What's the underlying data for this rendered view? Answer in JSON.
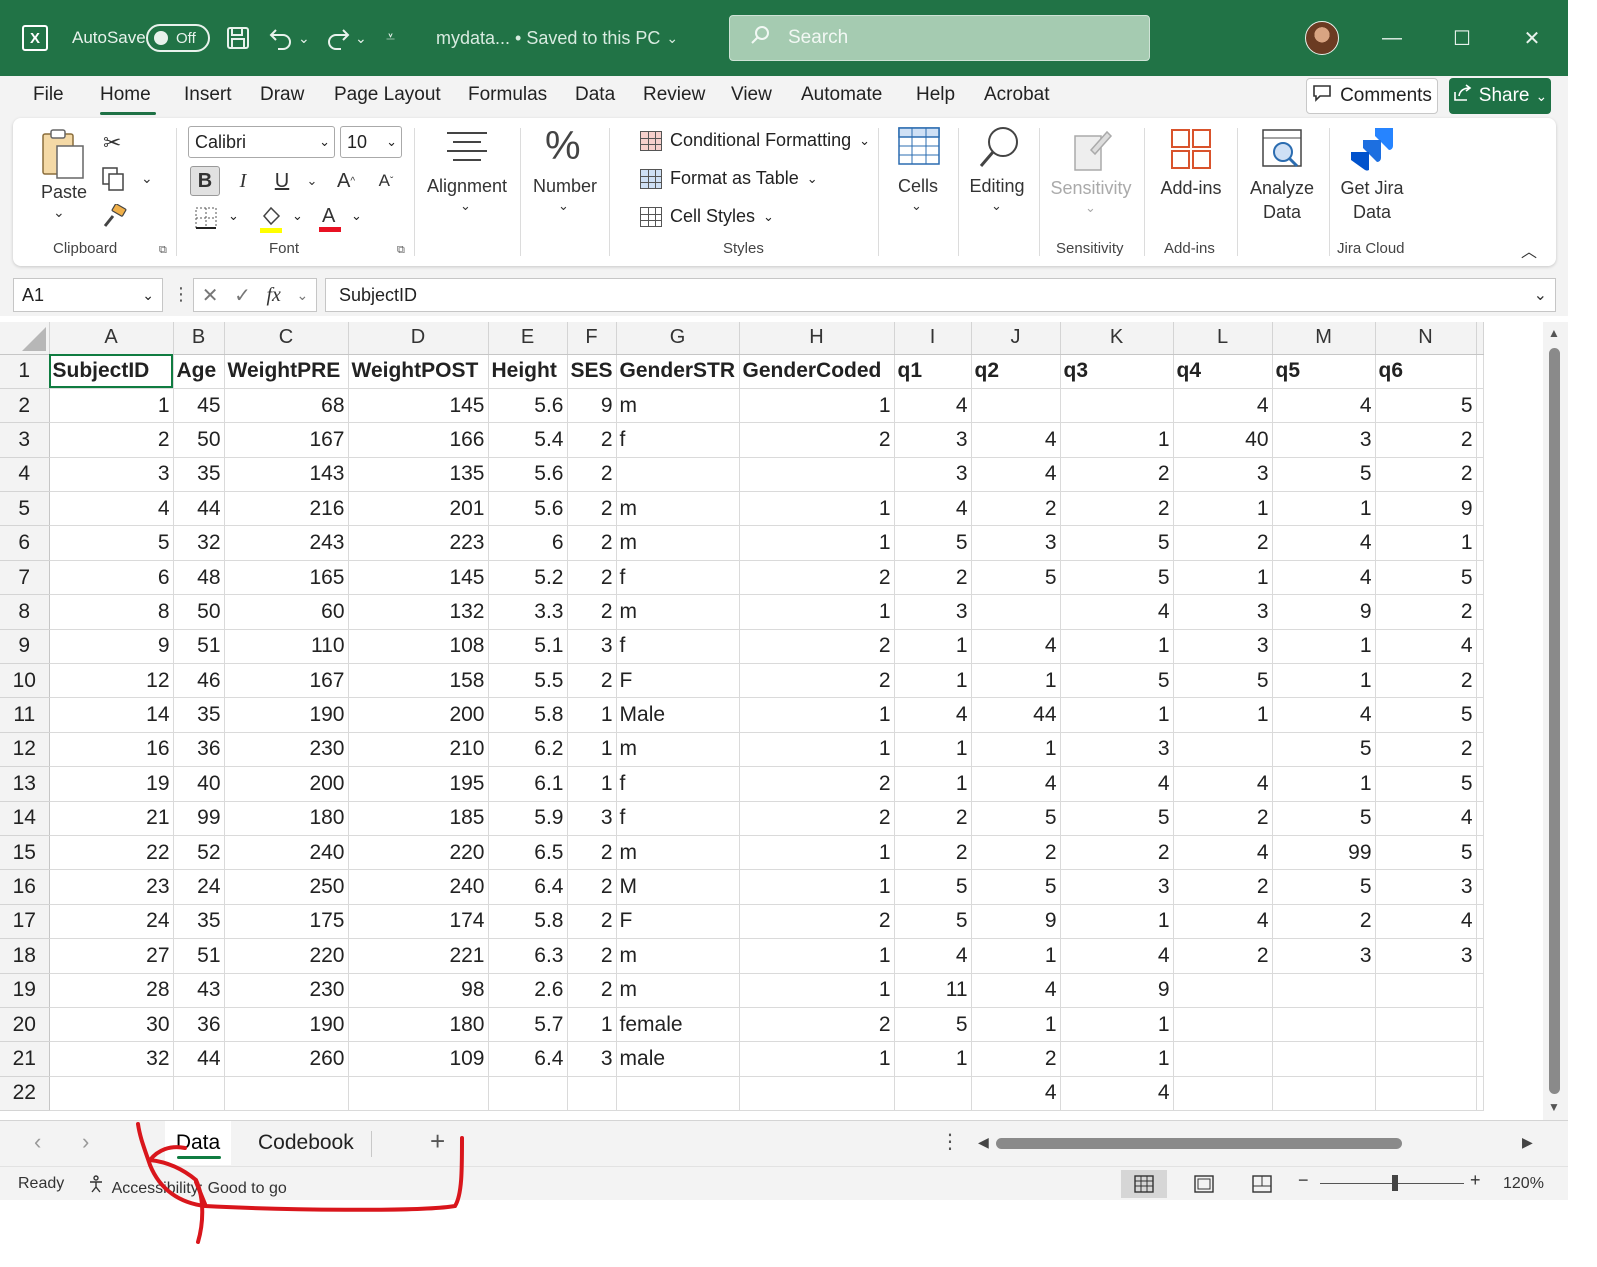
{
  "titlebar": {
    "autosave_label": "AutoSave",
    "autosave_state": "Off",
    "document_title": "mydata... • Saved to this PC",
    "search_placeholder": "Search",
    "brand_color": "#217346"
  },
  "menu": {
    "tabs": [
      "File",
      "Home",
      "Insert",
      "Draw",
      "Page Layout",
      "Formulas",
      "Data",
      "Review",
      "View",
      "Automate",
      "Help",
      "Acrobat"
    ],
    "active": "Home",
    "comments_label": "Comments",
    "share_label": "Share"
  },
  "ribbon": {
    "paste_label": "Paste",
    "clipboard_group": "Clipboard",
    "font_name": "Calibri",
    "font_size": "10",
    "font_group": "Font",
    "alignment_label": "Alignment",
    "number_label": "Number",
    "conditional_formatting": "Conditional Formatting",
    "format_as_table": "Format as Table",
    "cell_styles": "Cell Styles",
    "styles_group": "Styles",
    "cells_label": "Cells",
    "editing_label": "Editing",
    "sensitivity_label": "Sensitivity",
    "sensitivity_group": "Sensitivity",
    "addins_label": "Add-ins",
    "addins_group": "Add-ins",
    "analyze_label_1": "Analyze",
    "analyze_label_2": "Data",
    "jira_label_1": "Get Jira",
    "jira_label_2": "Data",
    "jira_group": "Jira Cloud"
  },
  "formula_bar": {
    "name_box": "A1",
    "fx": "fx",
    "formula": "SubjectID"
  },
  "sheet": {
    "columns": [
      "A",
      "B",
      "C",
      "D",
      "E",
      "F",
      "G",
      "H",
      "I",
      "J",
      "K",
      "L",
      "M",
      "N"
    ],
    "rows": [
      [
        "SubjectID",
        "Age",
        "WeightPRE",
        "WeightPOST",
        "Height",
        "SES",
        "GenderSTR",
        "GenderCoded",
        "q1",
        "q2",
        "q3",
        "q4",
        "q5",
        "q6"
      ],
      [
        "1",
        "45",
        "68",
        "145",
        "5.6",
        "9",
        "m",
        "1",
        "4",
        "",
        "",
        "4",
        "4",
        "5"
      ],
      [
        "2",
        "50",
        "167",
        "166",
        "5.4",
        "2",
        "f",
        "2",
        "3",
        "4",
        "1",
        "40",
        "3",
        "2"
      ],
      [
        "3",
        "35",
        "143",
        "135",
        "5.6",
        "2",
        "",
        "",
        "3",
        "4",
        "2",
        "3",
        "5",
        "2"
      ],
      [
        "4",
        "44",
        "216",
        "201",
        "5.6",
        "2",
        "m",
        "1",
        "4",
        "2",
        "2",
        "1",
        "1",
        "9"
      ],
      [
        "5",
        "32",
        "243",
        "223",
        "6",
        "2",
        "m",
        "1",
        "5",
        "3",
        "5",
        "2",
        "4",
        "1"
      ],
      [
        "6",
        "48",
        "165",
        "145",
        "5.2",
        "2",
        "f",
        "2",
        "2",
        "5",
        "5",
        "1",
        "4",
        "5"
      ],
      [
        "8",
        "50",
        "60",
        "132",
        "3.3",
        "2",
        "m",
        "1",
        "3",
        "",
        "4",
        "3",
        "9",
        "2"
      ],
      [
        "9",
        "51",
        "110",
        "108",
        "5.1",
        "3",
        "f",
        "2",
        "1",
        "4",
        "1",
        "3",
        "1",
        "4"
      ],
      [
        "12",
        "46",
        "167",
        "158",
        "5.5",
        "2",
        "F",
        "2",
        "1",
        "1",
        "5",
        "5",
        "1",
        "2"
      ],
      [
        "14",
        "35",
        "190",
        "200",
        "5.8",
        "1",
        "Male",
        "1",
        "4",
        "44",
        "1",
        "1",
        "4",
        "5"
      ],
      [
        "16",
        "36",
        "230",
        "210",
        "6.2",
        "1",
        "m",
        "1",
        "1",
        "1",
        "3",
        "",
        "5",
        "2"
      ],
      [
        "19",
        "40",
        "200",
        "195",
        "6.1",
        "1",
        "f",
        "2",
        "1",
        "4",
        "4",
        "4",
        "1",
        "5"
      ],
      [
        "21",
        "99",
        "180",
        "185",
        "5.9",
        "3",
        "f",
        "2",
        "2",
        "5",
        "5",
        "2",
        "5",
        "4"
      ],
      [
        "22",
        "52",
        "240",
        "220",
        "6.5",
        "2",
        "m",
        "1",
        "2",
        "2",
        "2",
        "4",
        "99",
        "5"
      ],
      [
        "23",
        "24",
        "250",
        "240",
        "6.4",
        "2",
        "M",
        "1",
        "5",
        "5",
        "3",
        "2",
        "5",
        "3"
      ],
      [
        "24",
        "35",
        "175",
        "174",
        "5.8",
        "2",
        "F",
        "2",
        "5",
        "9",
        "1",
        "4",
        "2",
        "4"
      ],
      [
        "27",
        "51",
        "220",
        "221",
        "6.3",
        "2",
        "m",
        "1",
        "4",
        "1",
        "4",
        "2",
        "3",
        "3"
      ],
      [
        "28",
        "43",
        "230",
        "98",
        "2.6",
        "2",
        "m",
        "1",
        "11",
        "4",
        "9",
        "",
        "",
        ""
      ],
      [
        "30",
        "36",
        "190",
        "180",
        "5.7",
        "1",
        "female",
        "2",
        "5",
        "1",
        "1",
        "",
        "",
        ""
      ],
      [
        "32",
        "44",
        "260",
        "109",
        "6.4",
        "3",
        "male",
        "1",
        "1",
        "2",
        "1",
        "",
        "",
        ""
      ],
      [
        "",
        "",
        "",
        "",
        "",
        "",
        "",
        "",
        "",
        "4",
        "4",
        "",
        "",
        ""
      ]
    ]
  },
  "tabs": {
    "sheets": [
      "Data",
      "Codebook"
    ],
    "active": "Data"
  },
  "status": {
    "ready": "Ready",
    "accessibility": "Accessibility: Good to go",
    "zoom": "120%"
  },
  "annotation_color": "#d9161c"
}
